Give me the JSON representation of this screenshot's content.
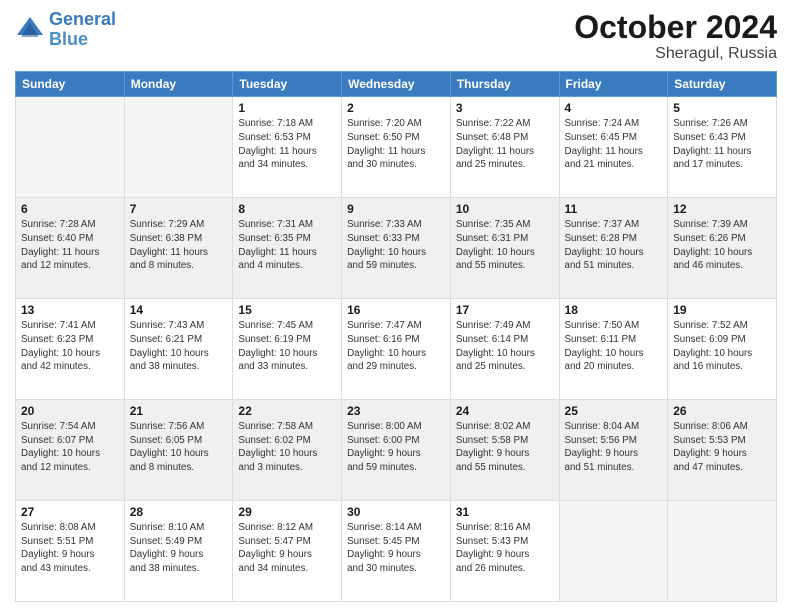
{
  "logo": {
    "line1": "General",
    "line2": "Blue"
  },
  "title": "October 2024",
  "location": "Sheragul, Russia",
  "days_header": [
    "Sunday",
    "Monday",
    "Tuesday",
    "Wednesday",
    "Thursday",
    "Friday",
    "Saturday"
  ],
  "weeks": [
    [
      {
        "day": "",
        "info": ""
      },
      {
        "day": "",
        "info": ""
      },
      {
        "day": "1",
        "info": "Sunrise: 7:18 AM\nSunset: 6:53 PM\nDaylight: 11 hours\nand 34 minutes."
      },
      {
        "day": "2",
        "info": "Sunrise: 7:20 AM\nSunset: 6:50 PM\nDaylight: 11 hours\nand 30 minutes."
      },
      {
        "day": "3",
        "info": "Sunrise: 7:22 AM\nSunset: 6:48 PM\nDaylight: 11 hours\nand 25 minutes."
      },
      {
        "day": "4",
        "info": "Sunrise: 7:24 AM\nSunset: 6:45 PM\nDaylight: 11 hours\nand 21 minutes."
      },
      {
        "day": "5",
        "info": "Sunrise: 7:26 AM\nSunset: 6:43 PM\nDaylight: 11 hours\nand 17 minutes."
      }
    ],
    [
      {
        "day": "6",
        "info": "Sunrise: 7:28 AM\nSunset: 6:40 PM\nDaylight: 11 hours\nand 12 minutes."
      },
      {
        "day": "7",
        "info": "Sunrise: 7:29 AM\nSunset: 6:38 PM\nDaylight: 11 hours\nand 8 minutes."
      },
      {
        "day": "8",
        "info": "Sunrise: 7:31 AM\nSunset: 6:35 PM\nDaylight: 11 hours\nand 4 minutes."
      },
      {
        "day": "9",
        "info": "Sunrise: 7:33 AM\nSunset: 6:33 PM\nDaylight: 10 hours\nand 59 minutes."
      },
      {
        "day": "10",
        "info": "Sunrise: 7:35 AM\nSunset: 6:31 PM\nDaylight: 10 hours\nand 55 minutes."
      },
      {
        "day": "11",
        "info": "Sunrise: 7:37 AM\nSunset: 6:28 PM\nDaylight: 10 hours\nand 51 minutes."
      },
      {
        "day": "12",
        "info": "Sunrise: 7:39 AM\nSunset: 6:26 PM\nDaylight: 10 hours\nand 46 minutes."
      }
    ],
    [
      {
        "day": "13",
        "info": "Sunrise: 7:41 AM\nSunset: 6:23 PM\nDaylight: 10 hours\nand 42 minutes."
      },
      {
        "day": "14",
        "info": "Sunrise: 7:43 AM\nSunset: 6:21 PM\nDaylight: 10 hours\nand 38 minutes."
      },
      {
        "day": "15",
        "info": "Sunrise: 7:45 AM\nSunset: 6:19 PM\nDaylight: 10 hours\nand 33 minutes."
      },
      {
        "day": "16",
        "info": "Sunrise: 7:47 AM\nSunset: 6:16 PM\nDaylight: 10 hours\nand 29 minutes."
      },
      {
        "day": "17",
        "info": "Sunrise: 7:49 AM\nSunset: 6:14 PM\nDaylight: 10 hours\nand 25 minutes."
      },
      {
        "day": "18",
        "info": "Sunrise: 7:50 AM\nSunset: 6:11 PM\nDaylight: 10 hours\nand 20 minutes."
      },
      {
        "day": "19",
        "info": "Sunrise: 7:52 AM\nSunset: 6:09 PM\nDaylight: 10 hours\nand 16 minutes."
      }
    ],
    [
      {
        "day": "20",
        "info": "Sunrise: 7:54 AM\nSunset: 6:07 PM\nDaylight: 10 hours\nand 12 minutes."
      },
      {
        "day": "21",
        "info": "Sunrise: 7:56 AM\nSunset: 6:05 PM\nDaylight: 10 hours\nand 8 minutes."
      },
      {
        "day": "22",
        "info": "Sunrise: 7:58 AM\nSunset: 6:02 PM\nDaylight: 10 hours\nand 3 minutes."
      },
      {
        "day": "23",
        "info": "Sunrise: 8:00 AM\nSunset: 6:00 PM\nDaylight: 9 hours\nand 59 minutes."
      },
      {
        "day": "24",
        "info": "Sunrise: 8:02 AM\nSunset: 5:58 PM\nDaylight: 9 hours\nand 55 minutes."
      },
      {
        "day": "25",
        "info": "Sunrise: 8:04 AM\nSunset: 5:56 PM\nDaylight: 9 hours\nand 51 minutes."
      },
      {
        "day": "26",
        "info": "Sunrise: 8:06 AM\nSunset: 5:53 PM\nDaylight: 9 hours\nand 47 minutes."
      }
    ],
    [
      {
        "day": "27",
        "info": "Sunrise: 8:08 AM\nSunset: 5:51 PM\nDaylight: 9 hours\nand 43 minutes."
      },
      {
        "day": "28",
        "info": "Sunrise: 8:10 AM\nSunset: 5:49 PM\nDaylight: 9 hours\nand 38 minutes."
      },
      {
        "day": "29",
        "info": "Sunrise: 8:12 AM\nSunset: 5:47 PM\nDaylight: 9 hours\nand 34 minutes."
      },
      {
        "day": "30",
        "info": "Sunrise: 8:14 AM\nSunset: 5:45 PM\nDaylight: 9 hours\nand 30 minutes."
      },
      {
        "day": "31",
        "info": "Sunrise: 8:16 AM\nSunset: 5:43 PM\nDaylight: 9 hours\nand 26 minutes."
      },
      {
        "day": "",
        "info": ""
      },
      {
        "day": "",
        "info": ""
      }
    ]
  ]
}
